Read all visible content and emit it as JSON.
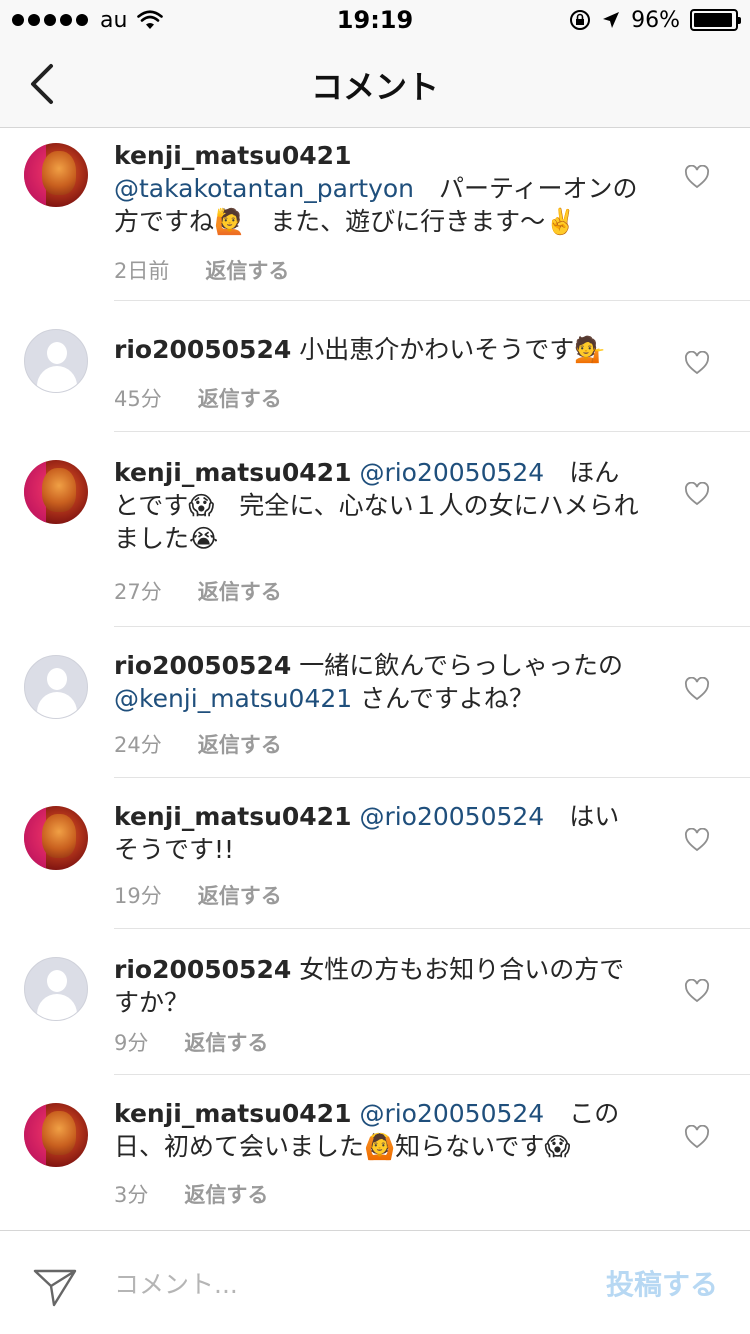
{
  "status_bar": {
    "carrier": "au",
    "time": "19:19",
    "battery": "96%",
    "battery_level": 0.96
  },
  "nav": {
    "title": "コメント"
  },
  "comments": [
    {
      "username": "kenji_matsu0421",
      "mention": "@takakotantan_partyon",
      "text": "　パーティーオンの方ですね🙋　また、遊びに行きます〜✌️",
      "time": "2日前",
      "reply_label": "返信する",
      "avatar": "profile-photo"
    },
    {
      "username": "rio20050524",
      "mention": "",
      "text": "小出恵介かわいそうです💁",
      "time": "45分",
      "reply_label": "返信する",
      "avatar": "default-avatar"
    },
    {
      "username": "kenji_matsu0421",
      "mention": "@rio20050524",
      "text": "　ほんとです😱　完全に、心ない１人の女にハメられました😭",
      "time": "27分",
      "reply_label": "返信する",
      "avatar": "profile-photo"
    },
    {
      "username": "rio20050524",
      "mention": "",
      "text_before": "一緒に飲んでらっしゃったの",
      "mention_after": "@kenji_matsu0421",
      "text_after": "さんですよね？",
      "time": "24分",
      "reply_label": "返信する",
      "avatar": "default-avatar"
    },
    {
      "username": "kenji_matsu0421",
      "mention": "@rio20050524",
      "text": "　はいそうです!!",
      "time": "19分",
      "reply_label": "返信する",
      "avatar": "profile-photo"
    },
    {
      "username": "rio20050524",
      "mention": "",
      "text": "女性の方もお知り合いの方ですか？",
      "time": "9分",
      "reply_label": "返信する",
      "avatar": "default-avatar"
    },
    {
      "username": "kenji_matsu0421",
      "mention": "@rio20050524",
      "text": "　この日、初めて会いました🙆知らないです😱",
      "time": "3分",
      "reply_label": "返信する",
      "avatar": "profile-photo"
    }
  ],
  "input": {
    "placeholder": "コメント...",
    "post_label": "投稿する",
    "post_color": "#b7d8f3"
  },
  "icons": {
    "back": "chevron-left-icon",
    "like": "heart-outline-icon",
    "send": "paper-plane-icon"
  }
}
